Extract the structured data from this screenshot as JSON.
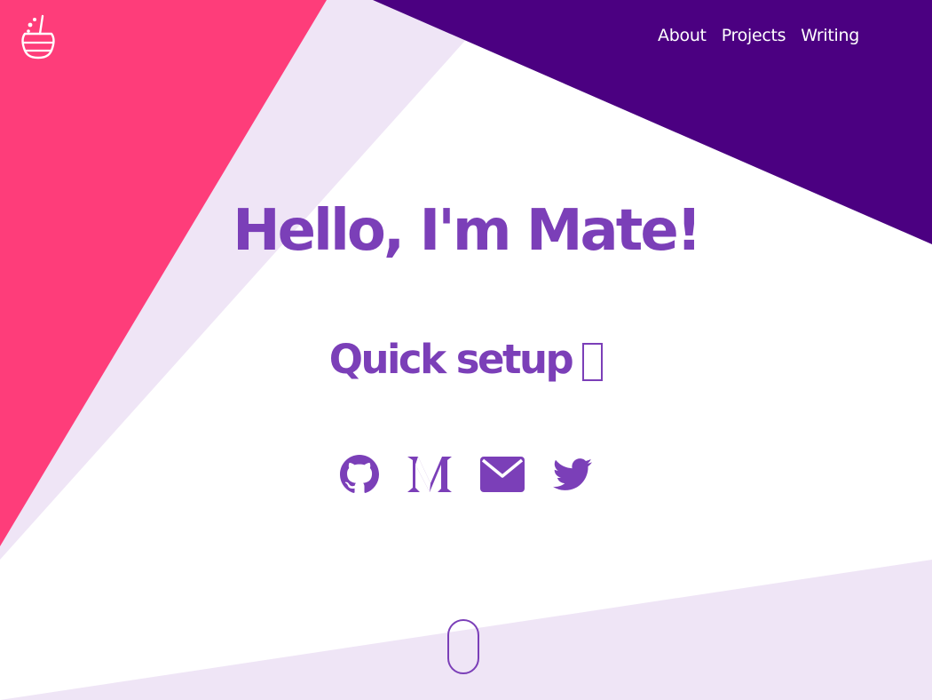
{
  "colors": {
    "pink": "#fe3d7a",
    "lavender": "#efe5f6",
    "deep_purple": "#4b0081",
    "accent": "#7b3fb8",
    "background": "#ffffff"
  },
  "header": {
    "logo_icon": "cauldron-icon",
    "nav": {
      "about": "About",
      "projects": "Projects",
      "writing": "Writing"
    }
  },
  "hero": {
    "title": "Hello, I'm Mate!",
    "subtitle": "Quick setup",
    "subtitle_glyph": "missing-glyph-box"
  },
  "socials": [
    {
      "icon": "github-icon"
    },
    {
      "icon": "medium-icon"
    },
    {
      "icon": "email-icon"
    },
    {
      "icon": "twitter-icon"
    }
  ],
  "scroll_indicator": {
    "icon": "scroll-down-mouse-icon"
  }
}
